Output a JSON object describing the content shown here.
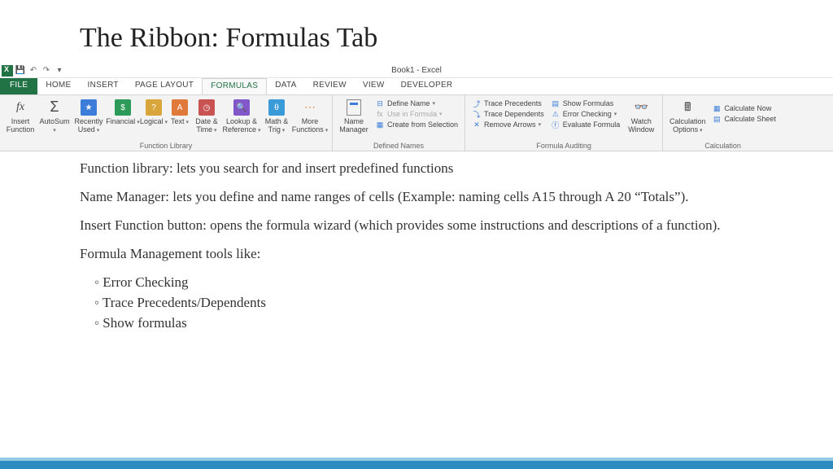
{
  "slide": {
    "title": "The Ribbon: Formulas Tab"
  },
  "qat": {
    "window_title": "Book1 - Excel"
  },
  "tabs": {
    "file": "FILE",
    "items": [
      "HOME",
      "INSERT",
      "PAGE LAYOUT",
      "FORMULAS",
      "DATA",
      "REVIEW",
      "VIEW",
      "DEVELOPER"
    ],
    "active_index": 3
  },
  "ribbon": {
    "function_library": {
      "label": "Function Library",
      "buttons": {
        "insert_function": "Insert Function",
        "autosum": "AutoSum",
        "recently_used": "Recently Used",
        "financial": "Financial",
        "logical": "Logical",
        "text": "Text",
        "date_time": "Date & Time",
        "lookup_ref": "Lookup & Reference",
        "math_trig": "Math & Trig",
        "more_functions": "More Functions"
      }
    },
    "defined_names": {
      "label": "Defined Names",
      "name_manager": "Name Manager",
      "define_name": "Define Name",
      "use_in_formula": "Use in Formula",
      "create_from_selection": "Create from Selection"
    },
    "formula_auditing": {
      "label": "Formula Auditing",
      "trace_precedents": "Trace Precedents",
      "trace_dependents": "Trace Dependents",
      "remove_arrows": "Remove Arrows",
      "show_formulas": "Show Formulas",
      "error_checking": "Error Checking",
      "evaluate_formula": "Evaluate Formula",
      "watch_window": "Watch Window"
    },
    "calculation": {
      "label": "Calculation",
      "calc_options": "Calculation Options",
      "calc_now": "Calculate Now",
      "calc_sheet": "Calculate Sheet"
    }
  },
  "body": {
    "p1": "Function library: lets you search for and insert predefined functions",
    "p2": "Name Manager: lets you define and name ranges of cells (Example: naming cells A15 through A 20 “Totals”).",
    "p3": "Insert Function button: opens the formula wizard (which provides some instructions and descriptions of a function).",
    "p4": "Formula Management tools like:",
    "bullets": [
      "Error Checking",
      "Trace Precedents/Dependents",
      "Show formulas"
    ]
  }
}
